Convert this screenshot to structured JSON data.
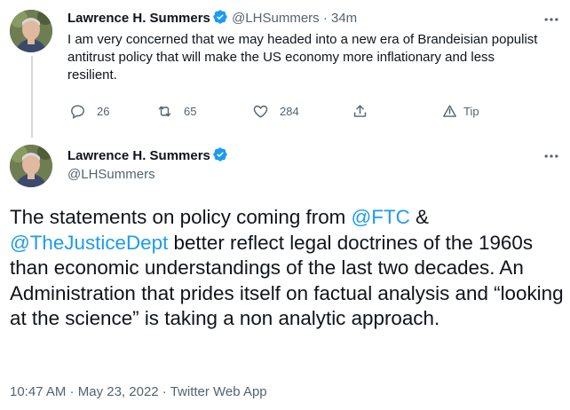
{
  "reply_tweet": {
    "author_name": "Lawrence H. Summers",
    "author_handle": "@LHSummers",
    "timestamp": "34m",
    "separator": "·",
    "text": "I am very concerned that we may headed into a new era of Brandeisian populist antitrust policy that will make the US economy more inflationary and less resilient.",
    "actions": {
      "replies": "26",
      "retweets": "65",
      "likes": "284",
      "tip_label": "Tip"
    }
  },
  "main_tweet": {
    "author_name": "Lawrence H. Summers",
    "author_handle": "@LHSummers",
    "text_parts": {
      "intro": "The statements on policy coming from ",
      "mention1": "@FTC",
      "amp": " & ",
      "mention2": "@TheJusticeDept",
      "body": " better reflect legal doctrines of the 1960s than economic understandings of the last two decades.  An Administration that prides itself on factual analysis and “looking at the science” is taking a non analytic approach."
    },
    "meta": {
      "time": "10:47 AM",
      "sep1": " · ",
      "date": "May 23, 2022",
      "sep2": " · ",
      "source": "Twitter Web App"
    }
  },
  "colors": {
    "accent": "#1d9bf0",
    "text_primary": "#0f1419",
    "text_secondary": "#536471",
    "thread_line": "#cfd9de"
  },
  "icons": {
    "verified": "verified-badge-icon",
    "more": "more-options-icon",
    "reply": "reply-icon",
    "retweet": "retweet-icon",
    "like": "heart-icon",
    "share": "share-icon",
    "tip": "tip-icon"
  }
}
